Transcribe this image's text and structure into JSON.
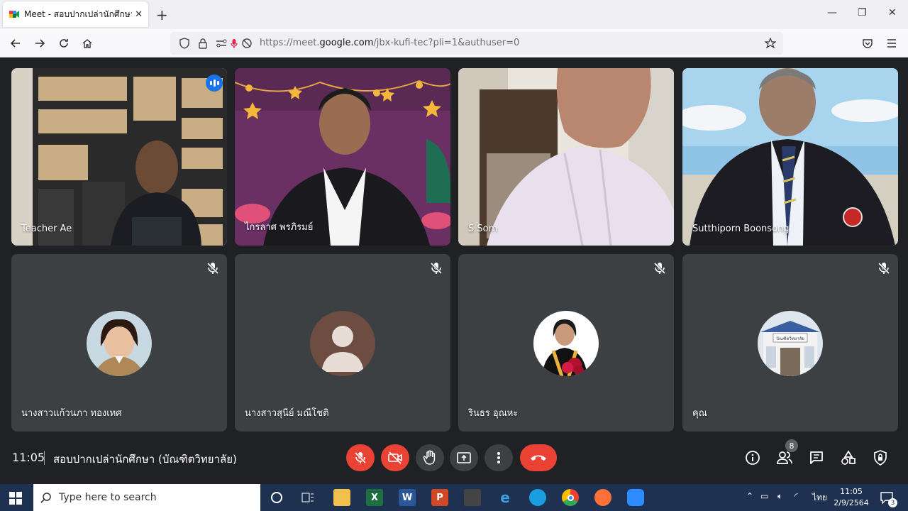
{
  "browser": {
    "tab_title": "Meet - สอบปากเปล่านักศึกษา (บั",
    "tab_close": "✕",
    "new_tab": "+",
    "window_min": "—",
    "window_max": "❐",
    "window_close": "✕",
    "url_prefix": "https://meet.",
    "url_domain": "google.com",
    "url_path": "/jbx-kufi-tec?pli=1&authuser=0"
  },
  "participants": [
    {
      "name": "Teacher Ae",
      "video": true
    },
    {
      "name": "ไกรลาศ พรภิรมย์",
      "video": true
    },
    {
      "name": "S Som",
      "video": true
    },
    {
      "name": "Sutthiporn Boonsong",
      "video": true
    },
    {
      "name": "นางสาวแก้วนภา ทองเทศ",
      "video": false,
      "muted": true
    },
    {
      "name": "นางสาวสุนีย์ มณีโชติ",
      "video": false,
      "muted": true
    },
    {
      "name": "รินธร อุณหะ",
      "video": false,
      "muted": true
    },
    {
      "name": "คุณ",
      "video": false,
      "muted": true
    }
  ],
  "meeting": {
    "time": "11:05",
    "title": "สอบปากเปล่านักศึกษา (บัณฑิตวิทยาลัย)",
    "participant_count": "8",
    "avatar_text_building": "บัณฑิตวิทยาลัย"
  },
  "colors": {
    "red": "#ea4335",
    "dark_tile": "#3c4043",
    "background": "#202124",
    "active_border": "#8ab4f8"
  },
  "taskbar": {
    "search_placeholder": "Type here to search",
    "clock_time": "11:05",
    "clock_date": "2/9/2564",
    "language": "ไทย",
    "notification_count": "3"
  }
}
